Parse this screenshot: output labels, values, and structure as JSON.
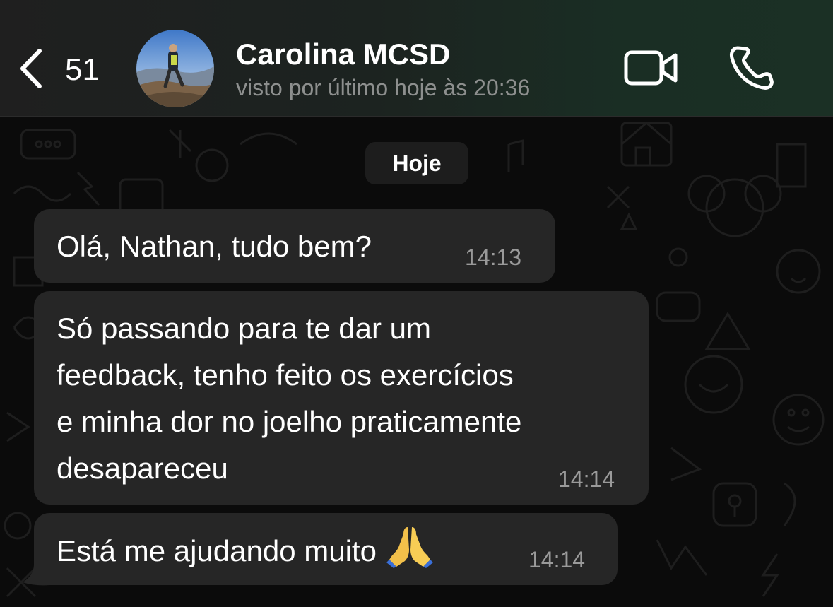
{
  "header": {
    "back_count": "51",
    "contact_name": "Carolina MCSD",
    "last_seen": "visto por último hoje às 20:36",
    "icons": [
      "chevron-left-icon",
      "video-camera-icon",
      "phone-icon"
    ]
  },
  "date_separator": "Hoje",
  "messages": [
    {
      "text": "Olá, Nathan, tudo bem?",
      "time": "14:13"
    },
    {
      "text": "Só passando para te dar um\nfeedback, tenho feito os exercícios\ne minha dor no joelho praticamente\ndesapareceu",
      "time": "14:14"
    },
    {
      "text": "Está me ajudando muito",
      "emoji": "praying-hands-emoji",
      "time": "14:14"
    }
  ],
  "colors": {
    "bubble": "#262626",
    "background": "#0b0b0b",
    "timestamp": "#9a9a9a",
    "last_seen": "#8d8f8e"
  }
}
